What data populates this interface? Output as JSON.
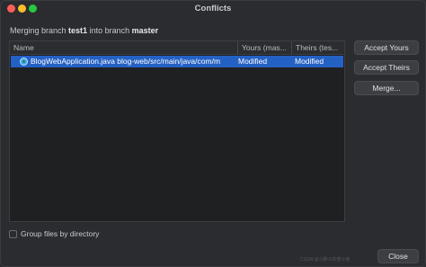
{
  "window": {
    "title": "Conflicts"
  },
  "merge_info": {
    "prefix": "Merging branch ",
    "source_branch": "test1",
    "middle": " into branch ",
    "target_branch": "master"
  },
  "table": {
    "columns": [
      "Name",
      "Yours (mas...",
      "Theirs (tes..."
    ],
    "rows": [
      {
        "name": "BlogWebApplication.java  blog-web/src/main/java/com/m",
        "yours": "Modified",
        "theirs": "Modified",
        "icon": "java-class-icon",
        "selected": true
      }
    ]
  },
  "buttons": {
    "accept_yours": "Accept Yours",
    "accept_theirs": "Accept Theirs",
    "merge": "Merge...",
    "close": "Close"
  },
  "options": {
    "group_by_directory": {
      "label": "Group files by directory",
      "checked": false
    }
  },
  "watermark": "CSDN @小胖子的奋斗者",
  "colors": {
    "selection": "#2461c4",
    "background": "#2b2c2f",
    "close": "#ff5f57",
    "minimize": "#febc2e",
    "maximize": "#28c840"
  }
}
